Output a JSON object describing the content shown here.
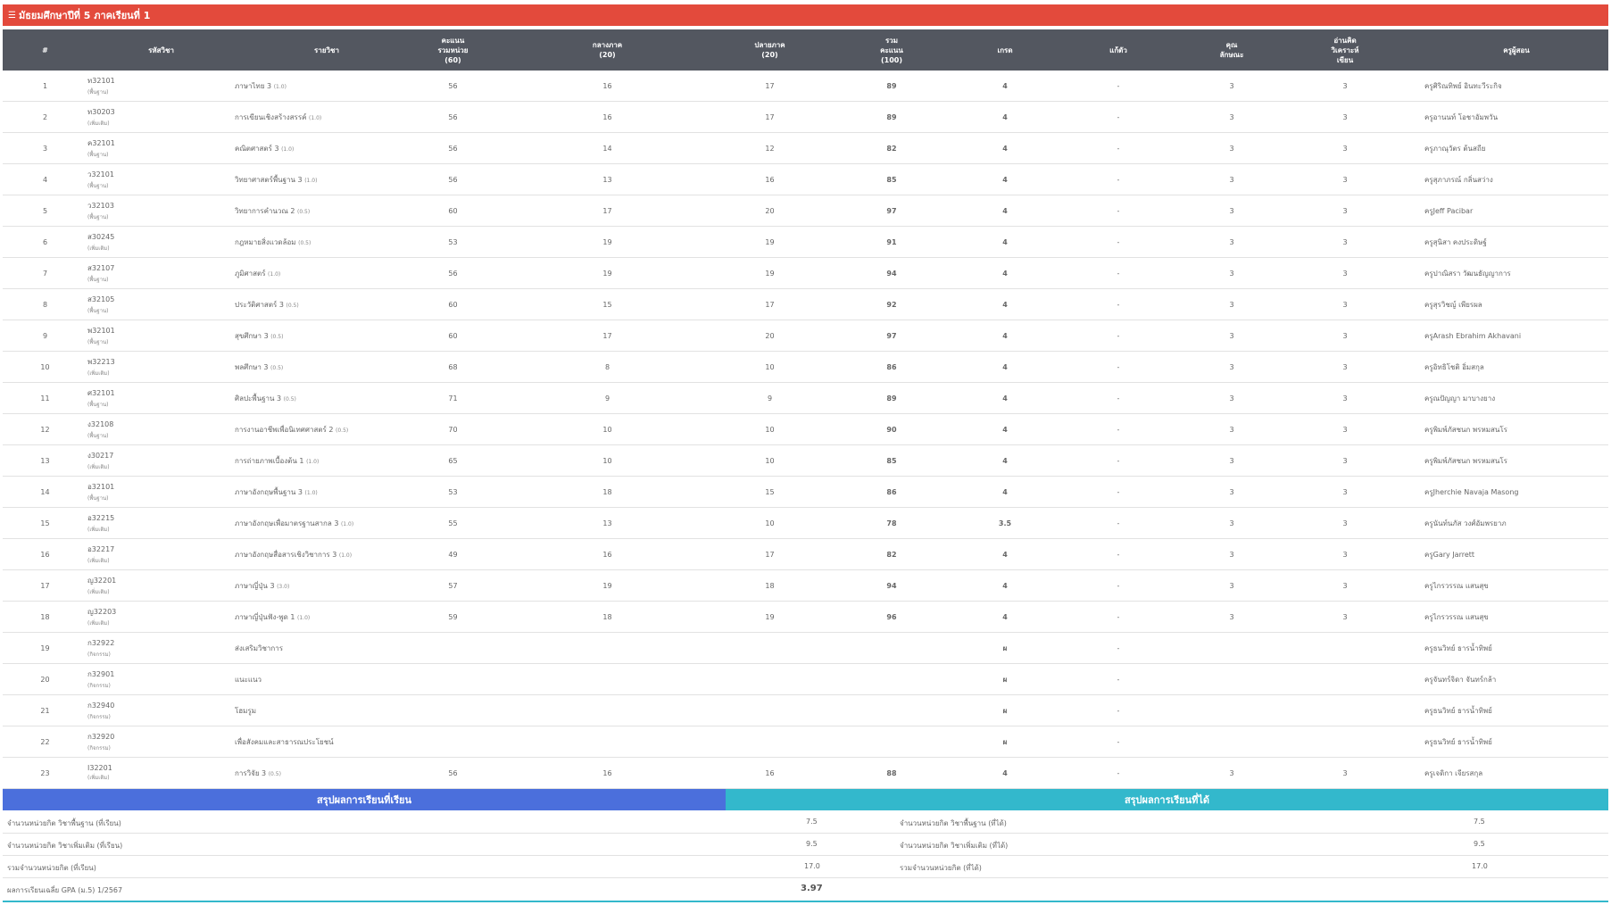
{
  "page": {
    "title": "มัธยมศึกษาปีที่ 5 ภาคเรียนที่ 1",
    "title_icon": "stack-icon"
  },
  "table": {
    "headers": {
      "no": "#",
      "code": "รหัสวิชา",
      "name": "รายวิชา",
      "unit_score_1": "คะแนน",
      "unit_score_2": "รวมหน่วย",
      "unit_score_3": "(60)",
      "midterm_1": "กลางภาค",
      "midterm_2": "(20)",
      "final_1": "ปลายภาค",
      "final_2": "(20)",
      "total_1": "รวม",
      "total_2": "คะแนน",
      "total_3": "(100)",
      "grade": "เกรด",
      "remedial": "แก้ตัว",
      "attribute_1": "คุณ",
      "attribute_2": "ลักษณะ",
      "reading_1": "อ่านคิด",
      "reading_2": "วิเคราะห์",
      "reading_3": "เขียน",
      "teacher": "ครูผู้สอน"
    },
    "rows": [
      {
        "no": "1",
        "code": "ท32101",
        "type": "(พื้นฐาน)",
        "name": "ภาษาไทย 3",
        "credit": "(1.0)",
        "unit": "56",
        "mid": "16",
        "final": "17",
        "total": "89",
        "grade": "4",
        "remedial": "-",
        "attr": "3",
        "read": "3",
        "teacher": "ครูศิริณทิพย์ อินทะวีระกิจ"
      },
      {
        "no": "2",
        "code": "ท30203",
        "type": "(เพิ่มเติม)",
        "name": "การเขียนเชิงสร้างสรรค์",
        "credit": "(1.0)",
        "unit": "56",
        "mid": "16",
        "final": "17",
        "total": "89",
        "grade": "4",
        "remedial": "-",
        "attr": "3",
        "read": "3",
        "teacher": "ครูอานนท์ โอชาอัมพวัน"
      },
      {
        "no": "3",
        "code": "ค32101",
        "type": "(พื้นฐาน)",
        "name": "คณิตศาสตร์ 3",
        "credit": "(1.0)",
        "unit": "56",
        "mid": "14",
        "final": "12",
        "total": "82",
        "grade": "4",
        "remedial": "-",
        "attr": "3",
        "read": "3",
        "teacher": "ครูภาณุวัตร ต้นสถีย"
      },
      {
        "no": "4",
        "code": "ว32101",
        "type": "(พื้นฐาน)",
        "name": "วิทยาศาสตร์พื้นฐาน 3",
        "credit": "(1.0)",
        "unit": "56",
        "mid": "13",
        "final": "16",
        "total": "85",
        "grade": "4",
        "remedial": "-",
        "attr": "3",
        "read": "3",
        "teacher": "ครูสุภาภรณ์ กลิ่นสว่าง"
      },
      {
        "no": "5",
        "code": "ว32103",
        "type": "(พื้นฐาน)",
        "name": "วิทยาการคำนวณ 2",
        "credit": "(0.5)",
        "unit": "60",
        "mid": "17",
        "final": "20",
        "total": "97",
        "grade": "4",
        "remedial": "-",
        "attr": "3",
        "read": "3",
        "teacher": "ครูJeff Pacibar"
      },
      {
        "no": "6",
        "code": "ส30245",
        "type": "(เพิ่มเติม)",
        "name": "กฎหมายสิ่งแวดล้อม",
        "credit": "(0.5)",
        "unit": "53",
        "mid": "19",
        "final": "19",
        "total": "91",
        "grade": "4",
        "remedial": "-",
        "attr": "3",
        "read": "3",
        "teacher": "ครูสุนิสา คงประดิษฐ์"
      },
      {
        "no": "7",
        "code": "ส32107",
        "type": "(พื้นฐาน)",
        "name": "ภูมิศาสตร์",
        "credit": "(1.0)",
        "unit": "56",
        "mid": "19",
        "final": "19",
        "total": "94",
        "grade": "4",
        "remedial": "-",
        "attr": "3",
        "read": "3",
        "teacher": "ครูปาณิสรา วัฒนธัญญาการ"
      },
      {
        "no": "8",
        "code": "ส32105",
        "type": "(พื้นฐาน)",
        "name": "ประวัติศาสตร์ 3",
        "credit": "(0.5)",
        "unit": "60",
        "mid": "15",
        "final": "17",
        "total": "92",
        "grade": "4",
        "remedial": "-",
        "attr": "3",
        "read": "3",
        "teacher": "ครูสุรวิชญ์ เพียรผล"
      },
      {
        "no": "9",
        "code": "พ32101",
        "type": "(พื้นฐาน)",
        "name": "สุขศึกษา 3",
        "credit": "(0.5)",
        "unit": "60",
        "mid": "17",
        "final": "20",
        "total": "97",
        "grade": "4",
        "remedial": "-",
        "attr": "3",
        "read": "3",
        "teacher": "ครูArash Ebrahim Akhavani"
      },
      {
        "no": "10",
        "code": "พ32213",
        "type": "(เพิ่มเติม)",
        "name": "พลศึกษา 3",
        "credit": "(0.5)",
        "unit": "68",
        "mid": "8",
        "final": "10",
        "total": "86",
        "grade": "4",
        "remedial": "-",
        "attr": "3",
        "read": "3",
        "teacher": "ครูอิทธิโชติ อิ่มสกุล"
      },
      {
        "no": "11",
        "code": "ศ32101",
        "type": "(พื้นฐาน)",
        "name": "ศิลปะพื้นฐาน 3",
        "credit": "(0.5)",
        "unit": "71",
        "mid": "9",
        "final": "9",
        "total": "89",
        "grade": "4",
        "remedial": "-",
        "attr": "3",
        "read": "3",
        "teacher": "ครูณปัญญา มาบางยาง"
      },
      {
        "no": "12",
        "code": "ง32108",
        "type": "(พื้นฐาน)",
        "name": "การงานอาชีพเพื่อนิเทศศาสตร์ 2",
        "credit": "(0.5)",
        "unit": "70",
        "mid": "10",
        "final": "10",
        "total": "90",
        "grade": "4",
        "remedial": "-",
        "attr": "3",
        "read": "3",
        "teacher": "ครูพิมพ์ภัสชนก พรหมสนโร"
      },
      {
        "no": "13",
        "code": "ง30217",
        "type": "(เพิ่มเติม)",
        "name": "การถ่ายภาพเบื้องต้น 1",
        "credit": "(1.0)",
        "unit": "65",
        "mid": "10",
        "final": "10",
        "total": "85",
        "grade": "4",
        "remedial": "-",
        "attr": "3",
        "read": "3",
        "teacher": "ครูพิมพ์ภัสชนก พรหมสนโร"
      },
      {
        "no": "14",
        "code": "อ32101",
        "type": "(พื้นฐาน)",
        "name": "ภาษาอังกฤษพื้นฐาน 3",
        "credit": "(1.0)",
        "unit": "53",
        "mid": "18",
        "final": "15",
        "total": "86",
        "grade": "4",
        "remedial": "-",
        "attr": "3",
        "read": "3",
        "teacher": "ครูJherchie Navaja Masong"
      },
      {
        "no": "15",
        "code": "อ32215",
        "type": "(เพิ่มเติม)",
        "name": "ภาษาอังกฤษเพื่อมาตรฐานสากล 3",
        "credit": "(1.0)",
        "unit": "55",
        "mid": "13",
        "final": "10",
        "total": "78",
        "grade": "3.5",
        "remedial": "-",
        "attr": "3",
        "read": "3",
        "teacher": "ครูนันท์นภัส วงศ์อัมพรยาภ"
      },
      {
        "no": "16",
        "code": "อ32217",
        "type": "(เพิ่มเติม)",
        "name": "ภาษาอังกฤษสื่อสารเชิงวิชาการ 3",
        "credit": "(1.0)",
        "unit": "49",
        "mid": "16",
        "final": "17",
        "total": "82",
        "grade": "4",
        "remedial": "-",
        "attr": "3",
        "read": "3",
        "teacher": "ครูGary Jarrett"
      },
      {
        "no": "17",
        "code": "ญ32201",
        "type": "(เพิ่มเติม)",
        "name": "ภาษาญี่ปุ่น 3",
        "credit": "(3.0)",
        "unit": "57",
        "mid": "19",
        "final": "18",
        "total": "94",
        "grade": "4",
        "remedial": "-",
        "attr": "3",
        "read": "3",
        "teacher": "ครูไกรวรรณ แสนสุข"
      },
      {
        "no": "18",
        "code": "ญ32203",
        "type": "(เพิ่มเติม)",
        "name": "ภาษาญี่ปุ่นฟัง-พูด 1",
        "credit": "(1.0)",
        "unit": "59",
        "mid": "18",
        "final": "19",
        "total": "96",
        "grade": "4",
        "remedial": "-",
        "attr": "3",
        "read": "3",
        "teacher": "ครูไกรวรรณ แสนสุข"
      },
      {
        "no": "19",
        "code": "ก32922",
        "type": "(กิจกรรม)",
        "name": "ส่งเสริมวิชาการ",
        "credit": "",
        "unit": "",
        "mid": "",
        "final": "",
        "total": "",
        "grade": "ผ",
        "remedial": "-",
        "attr": "",
        "read": "",
        "teacher": "ครูธนวิทย์ ธารน้ำทิพย์"
      },
      {
        "no": "20",
        "code": "ก32901",
        "type": "(กิจกรรม)",
        "name": "แนะแนว",
        "credit": "",
        "unit": "",
        "mid": "",
        "final": "",
        "total": "",
        "grade": "ผ",
        "remedial": "-",
        "attr": "",
        "read": "",
        "teacher": "ครูจันทร์จิดา จันทร์กล้า"
      },
      {
        "no": "21",
        "code": "ก32940",
        "type": "(กิจกรรม)",
        "name": "โฮมรูม",
        "credit": "",
        "unit": "",
        "mid": "",
        "final": "",
        "total": "",
        "grade": "ผ",
        "remedial": "-",
        "attr": "",
        "read": "",
        "teacher": "ครูธนวิทย์ ธารน้ำทิพย์"
      },
      {
        "no": "22",
        "code": "ก32920",
        "type": "(กิจกรรม)",
        "name": "เพื่อสังคมและสาธารณประโยชน์",
        "credit": "",
        "unit": "",
        "mid": "",
        "final": "",
        "total": "",
        "grade": "ผ",
        "remedial": "-",
        "attr": "",
        "read": "",
        "teacher": "ครูธนวิทย์ ธารน้ำทิพย์"
      },
      {
        "no": "23",
        "code": "I32201",
        "type": "(เพิ่มเติม)",
        "name": "การวิจัย 3",
        "credit": "(0.5)",
        "unit": "56",
        "mid": "16",
        "final": "16",
        "total": "88",
        "grade": "4",
        "remedial": "-",
        "attr": "3",
        "read": "3",
        "teacher": "ครูเจดิกา เจียรสกุล"
      }
    ]
  },
  "summary": {
    "left_title": "สรุปผลการเรียนที่เรียน",
    "right_title": "สรุปผลการเรียนที่ได้",
    "rows": [
      {
        "left_label": "จำนวนหน่วยกิต วิชาพื้นฐาน (ที่เรียน)",
        "left_value": "7.5",
        "right_label": "จำนวนหน่วยกิต วิชาพื้นฐาน (ที่ได้)",
        "right_value": "7.5"
      },
      {
        "left_label": "จำนวนหน่วยกิต วิชาเพิ่มเติม (ที่เรียน)",
        "left_value": "9.5",
        "right_label": "จำนวนหน่วยกิต วิชาเพิ่มเติม (ที่ได้)",
        "right_value": "9.5"
      },
      {
        "left_label": "รวมจำนวนหน่วยกิต (ที่เรียน)",
        "left_value": "17.0",
        "right_label": "รวมจำนวนหน่วยกิต (ที่ได้)",
        "right_value": "17.0"
      }
    ],
    "gpa_label": "ผลการเรียนเฉลี่ย GPA (ม.5) 1/2567",
    "gpa_value": "3.97"
  },
  "colors": {
    "title_bar": "#e34a3c",
    "table_header": "#535760",
    "summary_left": "#4b6fdc",
    "summary_right": "#33b8cc"
  }
}
